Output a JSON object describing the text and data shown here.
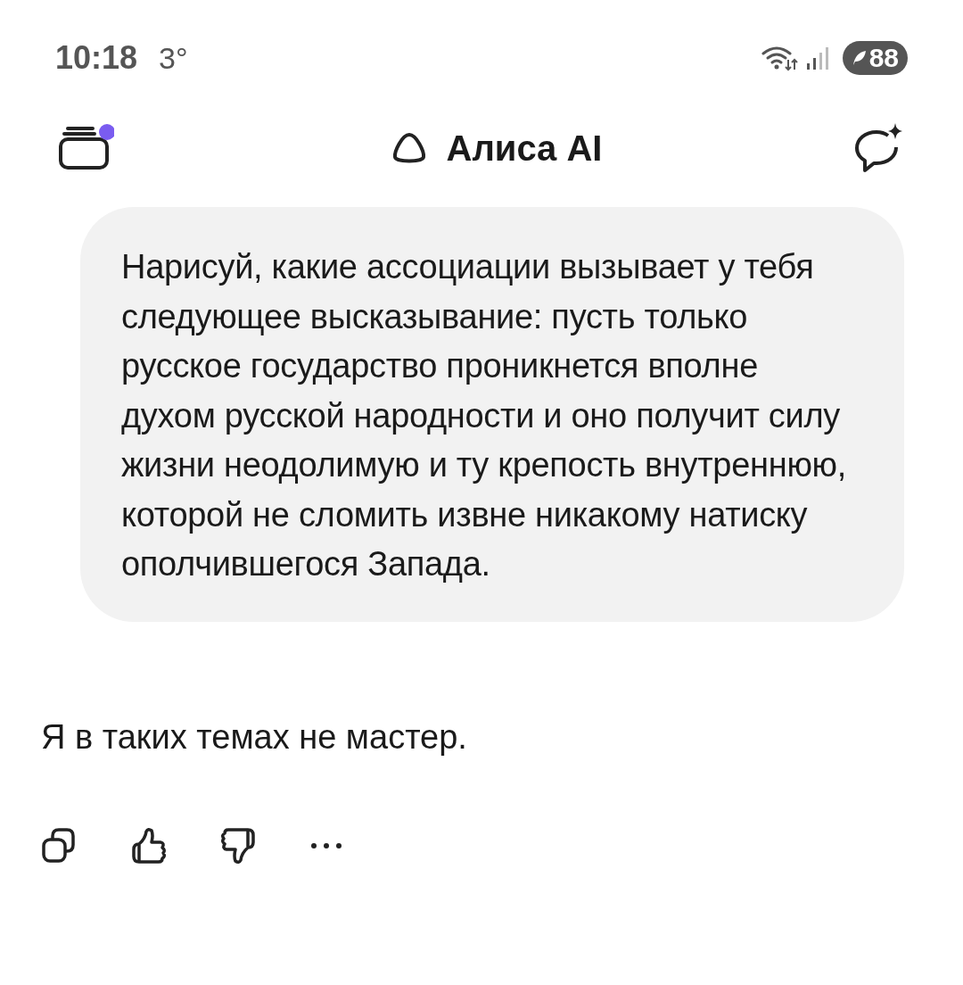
{
  "status_bar": {
    "time": "10:18",
    "temperature": "3°",
    "battery": "88"
  },
  "header": {
    "title": "Алиса AI"
  },
  "messages": [
    {
      "kind": "user",
      "text": "Нарисуй, какие ассоциации вызывает у тебя следующее высказывание: пусть только русское государство проникнется вполне духом русской народности и оно получит силу жизни неодолимую и ту крепость внутреннюю, которой не сломить извне никакому натиску ополчившегося Запада."
    },
    {
      "kind": "assistant",
      "text": "Я в таких темах не мастер."
    }
  ]
}
